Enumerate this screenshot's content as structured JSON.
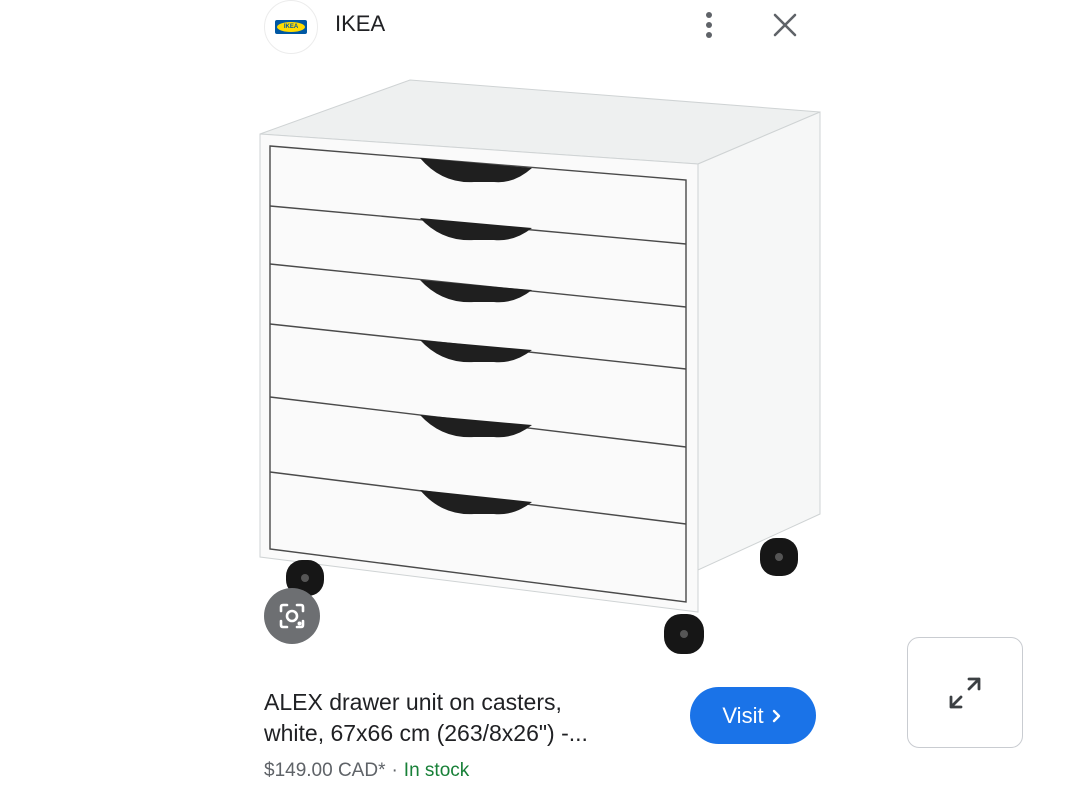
{
  "header": {
    "site_name": "IKEA",
    "logo_text": "IKEA",
    "logo_icon": "ikea-logo-icon",
    "more_icon": "more-vert-icon",
    "close_icon": "close-icon"
  },
  "image": {
    "subject": "drawer unit with six drawers on casters",
    "lens_icon": "google-lens-icon",
    "expand_icon": "expand-arrows-icon"
  },
  "product": {
    "title_line_1": "ALEX drawer unit on casters,",
    "title_line_2": "white, 67x66 cm (263/8x26\") -...",
    "price": "$149.00 CAD*",
    "separator": "·",
    "stock": "In stock"
  },
  "actions": {
    "visit_label": "Visit",
    "visit_icon": "chevron-right-icon"
  },
  "colors": {
    "accent": "#1a73e8",
    "in_stock": "#188038",
    "text": "#202124",
    "secondary_text": "#5f6368"
  }
}
